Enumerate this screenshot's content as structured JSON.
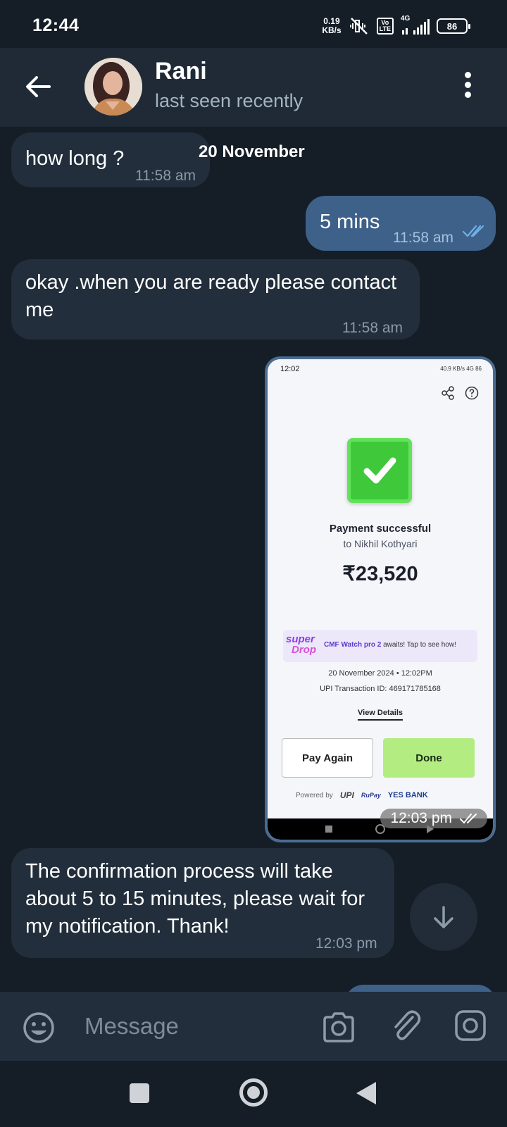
{
  "status_bar": {
    "time": "12:44",
    "net_speed_value": "0.19",
    "net_speed_unit": "KB/s",
    "volte": "Vo\nLTE",
    "network": "4G",
    "battery": "86"
  },
  "header": {
    "contact_name": "Rani",
    "contact_status": "last seen recently"
  },
  "chat": {
    "date_divider": "20 November",
    "messages": [
      {
        "direction": "in",
        "text": "how long ?",
        "time": "11:58 am"
      },
      {
        "direction": "out",
        "text": "5 mins",
        "time": "11:58 am"
      },
      {
        "direction": "in",
        "text": "okay .when you are ready please contact me",
        "time": "11:58 am"
      },
      {
        "direction": "out",
        "type": "image",
        "time": "12:03 pm"
      },
      {
        "direction": "in",
        "text": "The confirmation process will take about 5 to 15 minutes, please wait for my notification. Thank!",
        "time": "12:03 pm"
      }
    ]
  },
  "payment_screenshot": {
    "status_time": "12:02",
    "status_right": "40.9 KB/s  4G  86",
    "title": "Payment successful",
    "recipient": "to Nikhil Kothyari",
    "amount": "₹23,520",
    "promo_logo_line1": "super",
    "promo_logo_line2": "Drop",
    "promo_bold": "CMF Watch pro 2",
    "promo_text": " awaits! Tap to see how!",
    "date": "20 November 2024 • 12:02PM",
    "transaction": "UPI Transaction ID: 469171785168",
    "view_details": "View Details",
    "pay_again": "Pay Again",
    "done": "Done",
    "powered_by": "Powered by",
    "upi": "UPI",
    "rupay": "RuPay",
    "bank": "YES BANK"
  },
  "input": {
    "placeholder": "Message"
  },
  "colors": {
    "background": "#151e27",
    "header": "#1f2a36",
    "incoming_bubble": "#222e3b",
    "outgoing_bubble": "#3e6189",
    "done_button": "#b3ed82"
  }
}
